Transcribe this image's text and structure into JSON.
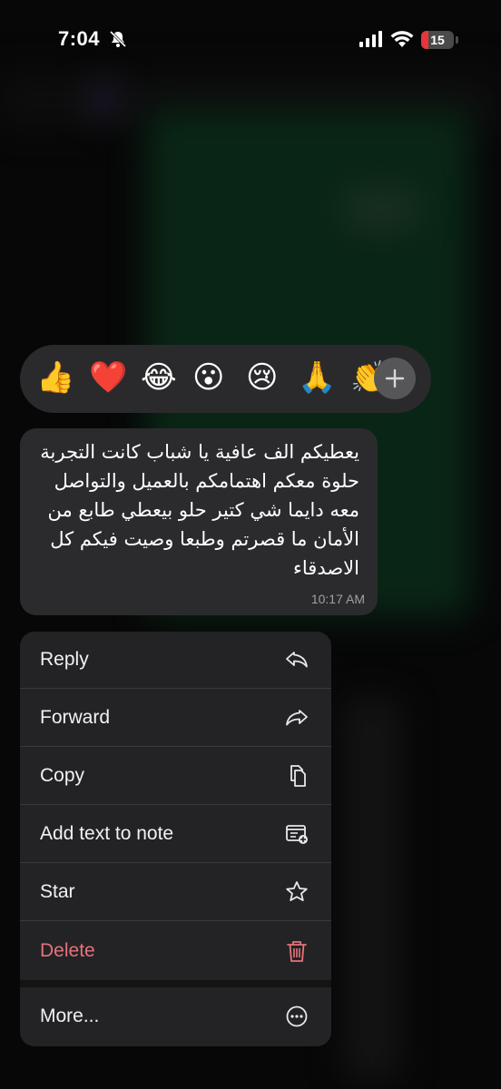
{
  "status_bar": {
    "time": "7:04",
    "battery": "15"
  },
  "reactions": {
    "emojis": [
      "👍",
      "❤️",
      "😂",
      "😮",
      "😢",
      "🙏",
      "👏"
    ],
    "more_icon": "plus-icon"
  },
  "message": {
    "text": "يعطيكم الف عافية يا شباب كانت التجربة حلوة معكم اهتمامكم بالعميل والتواصل معه دايما شي كتير حلو بيعطي طابع من الأمان ما قصرتم وطبعا وصيت فيكم كل الاصدقاء",
    "time": "10:17 AM"
  },
  "menu": {
    "reply": "Reply",
    "forward": "Forward",
    "copy": "Copy",
    "add_note": "Add text to note",
    "star": "Star",
    "delete": "Delete",
    "more": "More..."
  },
  "colors": {
    "delete": "#e5737a",
    "battery_low": "#e5373b"
  }
}
